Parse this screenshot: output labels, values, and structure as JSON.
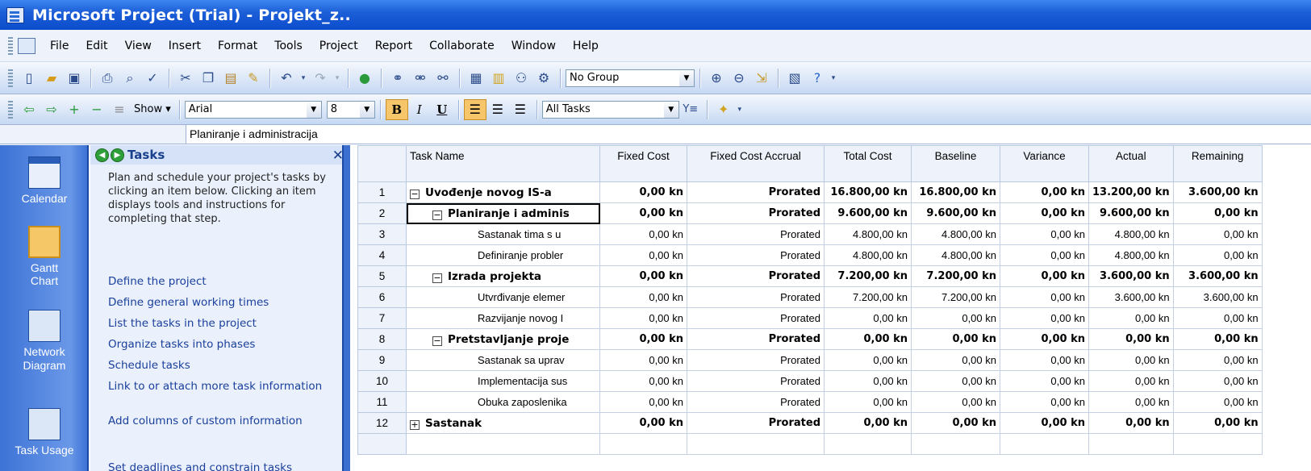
{
  "window": {
    "title": "Microsoft Project (Trial) - Projekt_z.."
  },
  "menu": [
    "File",
    "Edit",
    "View",
    "Insert",
    "Format",
    "Tools",
    "Project",
    "Report",
    "Collaborate",
    "Window",
    "Help"
  ],
  "toolbar1": {
    "group_combo": "No Group"
  },
  "toolbar2": {
    "show_label": "Show",
    "font_combo": "Arial",
    "size_combo": "8",
    "filter_combo": "All Tasks"
  },
  "entry_bar": {
    "value": "Planiranje i administracija"
  },
  "view_bar": [
    {
      "label": "Calendar",
      "icon": "calendar-icon"
    },
    {
      "label": "Gantt Chart",
      "icon": "gantt-chart-icon"
    },
    {
      "label": "Network Diagram",
      "icon": "network-diagram-icon"
    },
    {
      "label": "Task Usage",
      "icon": "task-usage-icon"
    }
  ],
  "task_pane": {
    "title": "Tasks",
    "description": "Plan and schedule your project's tasks by clicking an item below. Clicking an item displays tools and instructions for completing that step.",
    "links": [
      "Define the project",
      "Define general working times",
      "List the tasks in the project",
      "Organize tasks into phases",
      "Schedule tasks",
      "Link to or attach more task information",
      "Add columns of custom information",
      "Set deadlines and constrain tasks"
    ]
  },
  "grid": {
    "columns": [
      "Task Name",
      "Fixed Cost",
      "Fixed Cost Accrual",
      "Total Cost",
      "Baseline",
      "Variance",
      "Actual",
      "Remaining"
    ],
    "rows": [
      {
        "id": "1",
        "level": 0,
        "summary": true,
        "toggle": "−",
        "name": "Uvođenje novog IS-a",
        "fixed_cost": "0,00 kn",
        "accrual": "Prorated",
        "total": "16.800,00 kn",
        "baseline": "16.800,00 kn",
        "variance": "0,00 kn",
        "actual": "13.200,00 kn",
        "remaining": "3.600,00 kn"
      },
      {
        "id": "2",
        "level": 1,
        "summary": true,
        "toggle": "−",
        "name": "Planiranje i adminis",
        "fixed_cost": "0,00 kn",
        "accrual": "Prorated",
        "total": "9.600,00 kn",
        "baseline": "9.600,00 kn",
        "variance": "0,00 kn",
        "actual": "9.600,00 kn",
        "remaining": "0,00 kn"
      },
      {
        "id": "3",
        "level": 2,
        "summary": false,
        "toggle": "",
        "name": "Sastanak tima s u",
        "fixed_cost": "0,00 kn",
        "accrual": "Prorated",
        "total": "4.800,00 kn",
        "baseline": "4.800,00 kn",
        "variance": "0,00 kn",
        "actual": "4.800,00 kn",
        "remaining": "0,00 kn"
      },
      {
        "id": "4",
        "level": 2,
        "summary": false,
        "toggle": "",
        "name": "Definiranje probler",
        "fixed_cost": "0,00 kn",
        "accrual": "Prorated",
        "total": "4.800,00 kn",
        "baseline": "4.800,00 kn",
        "variance": "0,00 kn",
        "actual": "4.800,00 kn",
        "remaining": "0,00 kn"
      },
      {
        "id": "5",
        "level": 1,
        "summary": true,
        "toggle": "−",
        "name": "Izrada projekta",
        "fixed_cost": "0,00 kn",
        "accrual": "Prorated",
        "total": "7.200,00 kn",
        "baseline": "7.200,00 kn",
        "variance": "0,00 kn",
        "actual": "3.600,00 kn",
        "remaining": "3.600,00 kn"
      },
      {
        "id": "6",
        "level": 2,
        "summary": false,
        "toggle": "",
        "name": "Utvrđivanje elemer",
        "fixed_cost": "0,00 kn",
        "accrual": "Prorated",
        "total": "7.200,00 kn",
        "baseline": "7.200,00 kn",
        "variance": "0,00 kn",
        "actual": "3.600,00 kn",
        "remaining": "3.600,00 kn"
      },
      {
        "id": "7",
        "level": 2,
        "summary": false,
        "toggle": "",
        "name": "Razvijanje novog I",
        "fixed_cost": "0,00 kn",
        "accrual": "Prorated",
        "total": "0,00 kn",
        "baseline": "0,00 kn",
        "variance": "0,00 kn",
        "actual": "0,00 kn",
        "remaining": "0,00 kn"
      },
      {
        "id": "8",
        "level": 1,
        "summary": true,
        "toggle": "−",
        "name": "Pretstavljanje proje",
        "fixed_cost": "0,00 kn",
        "accrual": "Prorated",
        "total": "0,00 kn",
        "baseline": "0,00 kn",
        "variance": "0,00 kn",
        "actual": "0,00 kn",
        "remaining": "0,00 kn"
      },
      {
        "id": "9",
        "level": 2,
        "summary": false,
        "toggle": "",
        "name": "Sastanak sa uprav",
        "fixed_cost": "0,00 kn",
        "accrual": "Prorated",
        "total": "0,00 kn",
        "baseline": "0,00 kn",
        "variance": "0,00 kn",
        "actual": "0,00 kn",
        "remaining": "0,00 kn"
      },
      {
        "id": "10",
        "level": 2,
        "summary": false,
        "toggle": "",
        "name": "Implementacija sus",
        "fixed_cost": "0,00 kn",
        "accrual": "Prorated",
        "total": "0,00 kn",
        "baseline": "0,00 kn",
        "variance": "0,00 kn",
        "actual": "0,00 kn",
        "remaining": "0,00 kn"
      },
      {
        "id": "11",
        "level": 2,
        "summary": false,
        "toggle": "",
        "name": "Obuka zaposlenika",
        "fixed_cost": "0,00 kn",
        "accrual": "Prorated",
        "total": "0,00 kn",
        "baseline": "0,00 kn",
        "variance": "0,00 kn",
        "actual": "0,00 kn",
        "remaining": "0,00 kn"
      },
      {
        "id": "12",
        "level": 0,
        "summary": true,
        "toggle": "+",
        "name": "Sastanak",
        "fixed_cost": "0,00 kn",
        "accrual": "Prorated",
        "total": "0,00 kn",
        "baseline": "0,00 kn",
        "variance": "0,00 kn",
        "actual": "0,00 kn",
        "remaining": "0,00 kn"
      }
    ]
  }
}
